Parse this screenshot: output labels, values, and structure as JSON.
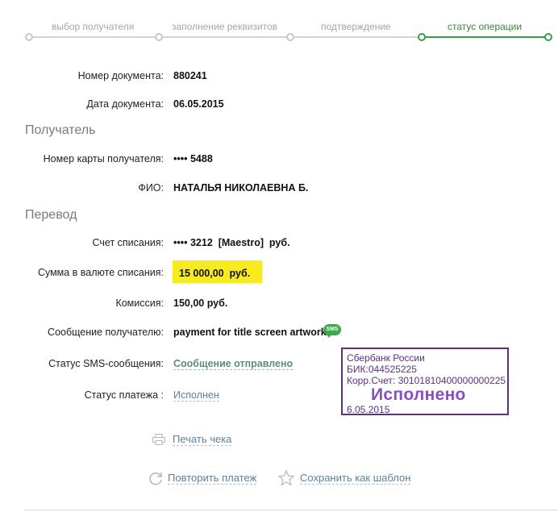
{
  "steps": [
    {
      "label": "выбор получателя",
      "state": "done"
    },
    {
      "label": "заполнение реквизитов",
      "state": "done"
    },
    {
      "label": "подтверждение",
      "state": "done"
    },
    {
      "label": "статус операции",
      "state": "active"
    }
  ],
  "doc": {
    "number_label": "Номер документа:",
    "number_value": "880241",
    "date_label": "Дата документа:",
    "date_value": "06.05.2015"
  },
  "recipient": {
    "section_title": "Получатель",
    "card_label": "Номер карты получателя:",
    "card_value": "•••• 5488",
    "name_label": "ФИО:",
    "name_value": "НАТАЛЬЯ НИКОЛАЕВНА Б."
  },
  "transfer": {
    "section_title": "Перевод",
    "account_label": "Счет списания:",
    "account_value": "•••• 3212  [Maestro]  руб.",
    "amount_label": "Сумма в валюте списания:",
    "amount_value": "15 000,00  руб.",
    "fee_label": "Комиссия:",
    "fee_value": "150,00 руб.",
    "message_label": "Сообщение получателю:",
    "message_value": "payment for title screen artwork",
    "sms_badge": "SMS",
    "sms_status_label": "Статус SMS-сообщения:",
    "sms_status_value": "Сообщение отправлено",
    "payment_status_label": "Статус платежа :",
    "payment_status_value": "Исполнен"
  },
  "stamp": {
    "bank": "Сбербанк России",
    "bik": "БИК:044525225",
    "corr": "Корр.Счет: 30101810400000000225",
    "status": "Исполнено",
    "date": "6.05.2015"
  },
  "actions": {
    "print": "Печать чека",
    "repeat": "Повторить платеж",
    "save_template": "Сохранить как шаблон"
  },
  "colors": {
    "accent_green": "#3a9b4a",
    "highlight_yellow": "#f7ea1e",
    "stamp_purple": "#5e2f84"
  }
}
